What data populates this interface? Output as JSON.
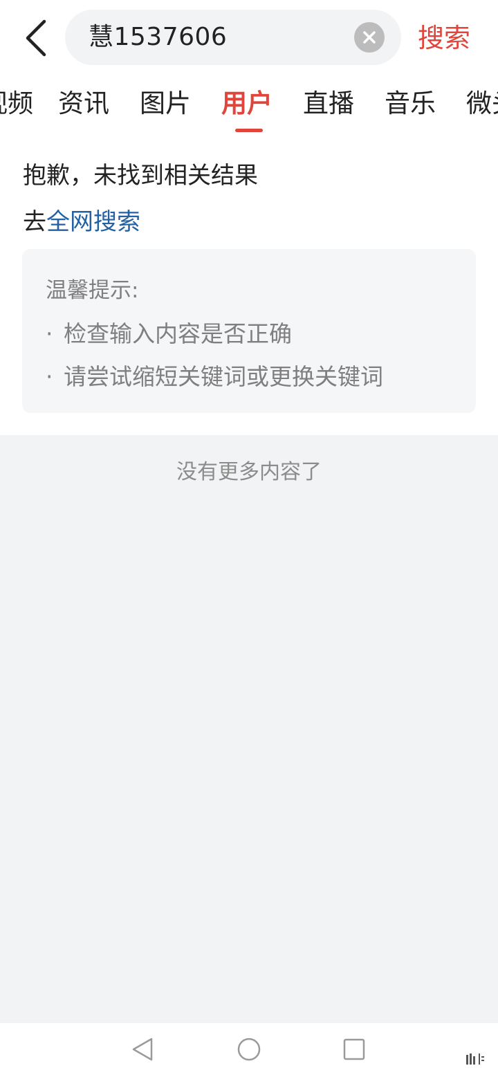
{
  "header": {
    "search_value": "慧1537606",
    "search_button": "搜索"
  },
  "tabs": [
    {
      "label": "视频"
    },
    {
      "label": "资讯"
    },
    {
      "label": "图片"
    },
    {
      "label": "用户",
      "active": true
    },
    {
      "label": "直播"
    },
    {
      "label": "音乐"
    },
    {
      "label": "微头条"
    }
  ],
  "result": {
    "sorry_text": "抱歉，未找到相关结果",
    "goto_prefix": "去",
    "goto_link": "全网搜索"
  },
  "tips": {
    "title": "温馨提示:",
    "items": [
      "检查输入内容是否正确",
      "请尝试缩短关键词或更换关键词"
    ],
    "bullet": "·"
  },
  "footer": {
    "no_more": "没有更多内容了"
  },
  "colors": {
    "accent": "#e0443b",
    "link": "#2361a3",
    "muted_text": "#7f7f7f",
    "gray_bg": "#f2f3f5"
  },
  "icons": {
    "back": "chevron-left-icon",
    "clear": "clear-circle-icon",
    "nav_back": "triangle-back-icon",
    "nav_home": "circle-home-icon",
    "nav_recent": "square-recent-icon"
  }
}
